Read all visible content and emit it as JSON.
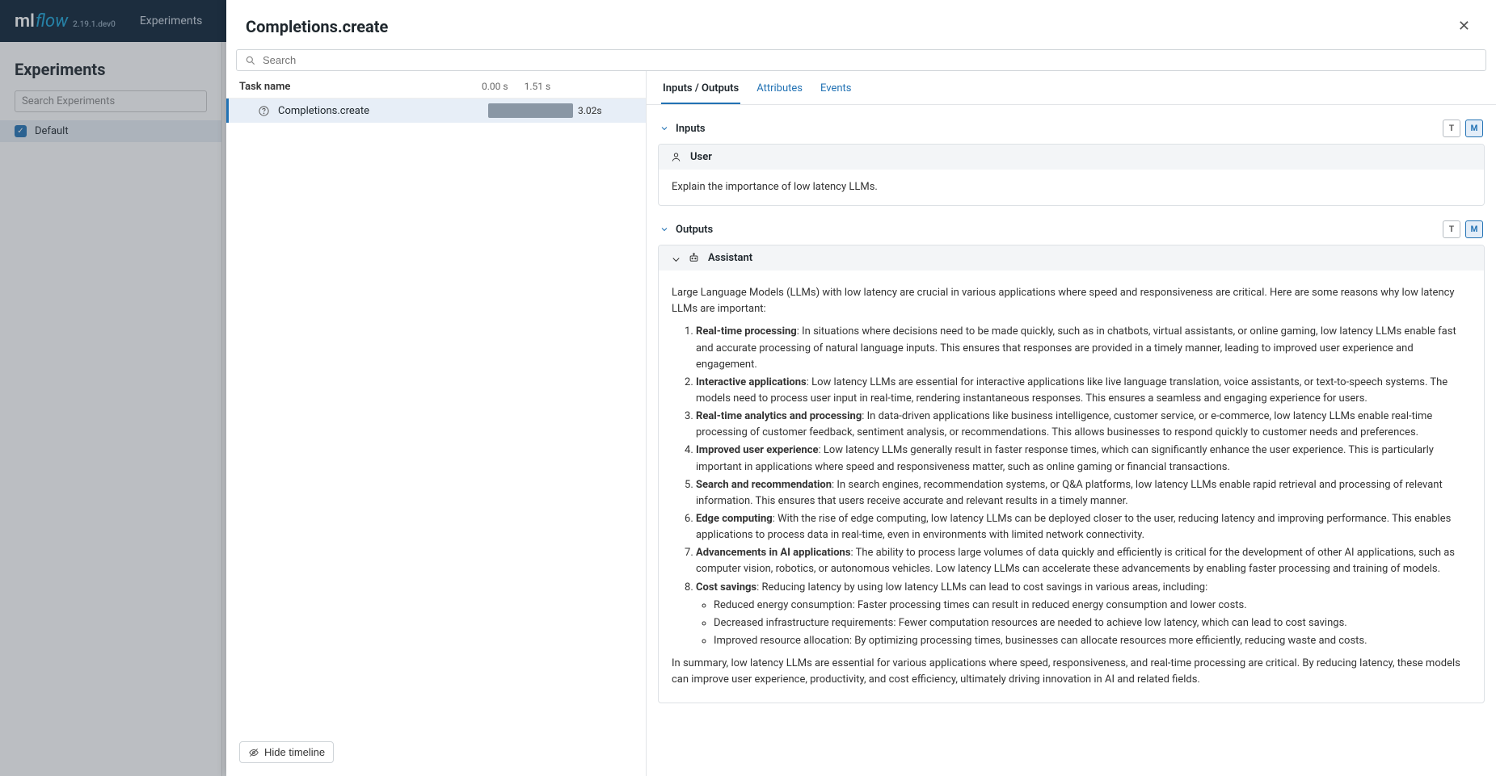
{
  "app": {
    "logo_ml": "ml",
    "logo_flow": "flow",
    "version": "2.19.1.dev0",
    "nav_experiments": "Experiments"
  },
  "sidebar": {
    "title": "Experiments",
    "search_placeholder": "Search Experiments",
    "item_default": "Default"
  },
  "panel": {
    "title": "Completions.create",
    "search_placeholder": "Search",
    "tasks_header": "Task name",
    "time_tick_0": "0.00 s",
    "time_tick_1": "1.51 s",
    "task0_label": "Completions.create",
    "task0_duration": "3.02s",
    "hide_timeline": "Hide timeline"
  },
  "tabs": {
    "io": "Inputs / Outputs",
    "attributes": "Attributes",
    "events": "Events"
  },
  "io": {
    "inputs_label": "Inputs",
    "outputs_label": "Outputs",
    "mode_text": "T",
    "mode_md": "M",
    "user_role": "User",
    "user_text": "Explain the importance of low latency LLMs.",
    "assistant_role": "Assistant",
    "assistant_intro": "Large Language Models (LLMs) with low latency are crucial in various applications where speed and responsiveness are critical. Here are some reasons why low latency LLMs are important:",
    "points": [
      {
        "title": "Real-time processing",
        "text": ": In situations where decisions need to be made quickly, such as in chatbots, virtual assistants, or online gaming, low latency LLMs enable fast and accurate processing of natural language inputs. This ensures that responses are provided in a timely manner, leading to improved user experience and engagement."
      },
      {
        "title": "Interactive applications",
        "text": ": Low latency LLMs are essential for interactive applications like live language translation, voice assistants, or text-to-speech systems. The models need to process user input in real-time, rendering instantaneous responses. This ensures a seamless and engaging experience for users."
      },
      {
        "title": "Real-time analytics and processing",
        "text": ": In data-driven applications like business intelligence, customer service, or e-commerce, low latency LLMs enable real-time processing of customer feedback, sentiment analysis, or recommendations. This allows businesses to respond quickly to customer needs and preferences."
      },
      {
        "title": "Improved user experience",
        "text": ": Low latency LLMs generally result in faster response times, which can significantly enhance the user experience. This is particularly important in applications where speed and responsiveness matter, such as online gaming or financial transactions."
      },
      {
        "title": "Search and recommendation",
        "text": ": In search engines, recommendation systems, or Q&A platforms, low latency LLMs enable rapid retrieval and processing of relevant information. This ensures that users receive accurate and relevant results in a timely manner."
      },
      {
        "title": "Edge computing",
        "text": ": With the rise of edge computing, low latency LLMs can be deployed closer to the user, reducing latency and improving performance. This enables applications to process data in real-time, even in environments with limited network connectivity."
      },
      {
        "title": "Advancements in AI applications",
        "text": ": The ability to process large volumes of data quickly and efficiently is critical for the development of other AI applications, such as computer vision, robotics, or autonomous vehicles. Low latency LLMs can accelerate these advancements by enabling faster processing and training of models."
      },
      {
        "title": "Cost savings",
        "text": ": Reducing latency by using low latency LLMs can lead to cost savings in various areas, including:"
      }
    ],
    "cost_sub": [
      "Reduced energy consumption: Faster processing times can result in reduced energy consumption and lower costs.",
      "Decreased infrastructure requirements: Fewer computation resources are needed to achieve low latency, which can lead to cost savings.",
      "Improved resource allocation: By optimizing processing times, businesses can allocate resources more efficiently, reducing waste and costs."
    ],
    "assistant_summary": "In summary, low latency LLMs are essential for various applications where speed, responsiveness, and real-time processing are critical. By reducing latency, these models can improve user experience, productivity, and cost efficiency, ultimately driving innovation in AI and related fields."
  }
}
